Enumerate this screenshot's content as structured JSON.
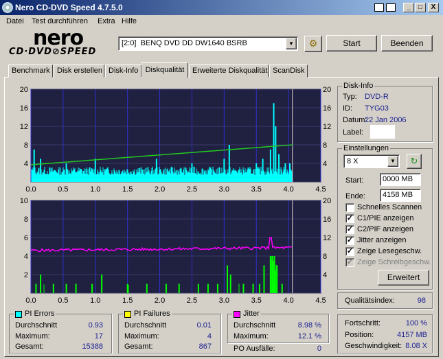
{
  "window": {
    "title": "Nero CD-DVD Speed 4.7.5.0",
    "min": "_",
    "max": "□",
    "close": "X"
  },
  "menu": [
    "Datei",
    "Test durchführen",
    "Extra",
    "Hilfe"
  ],
  "logo": {
    "top": "nero",
    "bottom": "CD·DVD⊘SPEED"
  },
  "drive": {
    "selected": "[2:0]  BENQ DVD DD DW1640 BSRB"
  },
  "buttons": {
    "start": "Start",
    "stop": "Beenden",
    "advanced": "Erweitert"
  },
  "tabs": [
    "Benchmark",
    "Disk erstellen",
    "Disk-Info",
    "Diskqualität",
    "Erweiterte Diskqualität",
    "ScanDisk"
  ],
  "active_tab": "Diskqualität",
  "disk_info": {
    "title": "Disk-Info",
    "type_label": "Typ:",
    "type": "DVD-R",
    "id_label": "ID:",
    "id": "TYG03",
    "date_label": "Datum:",
    "date": "22 Jan 2006",
    "label_label": "Label:"
  },
  "settings": {
    "title": "Einstellungen",
    "speed": "8 X",
    "start_label": "Start:",
    "start": "0000 MB",
    "end_label": "Ende:",
    "end": "4158 MB",
    "checks": [
      {
        "label": "Schnelles Scannen",
        "checked": false,
        "disabled": false
      },
      {
        "label": "C1/PIE anzeigen",
        "checked": true,
        "disabled": false
      },
      {
        "label": "C2/PIF anzeigen",
        "checked": true,
        "disabled": false
      },
      {
        "label": "Jitter anzeigen",
        "checked": true,
        "disabled": false
      },
      {
        "label": "Zeige Lesegeschw.",
        "checked": true,
        "disabled": false
      },
      {
        "label": "Zeige Schreibgeschw.",
        "checked": true,
        "disabled": true
      }
    ]
  },
  "quality": {
    "label": "Qualitätsindex:",
    "value": "98"
  },
  "progress": {
    "progress_label": "Fortschritt:",
    "progress": "100 %",
    "position_label": "Position:",
    "position": "4157 MB",
    "speed_label": "Geschwindigkeit:",
    "speed": "8.08 X"
  },
  "pi_errors": {
    "title": "PI Errors",
    "color": "#00ffff",
    "avg_label": "Durchschnitt",
    "avg": "0.93",
    "max_label": "Maximum:",
    "max": "17",
    "total_label": "Gesamt:",
    "total": "15388"
  },
  "pi_failures": {
    "title": "PI Failures",
    "color": "#ffff00",
    "avg_label": "Durchschnitt",
    "avg": "0.01",
    "max_label": "Maximum:",
    "max": "4",
    "total_label": "Gesamt:",
    "total": "867"
  },
  "jitter": {
    "title": "Jitter",
    "color": "#ff00ff",
    "avg_label": "Durchschnitt",
    "avg": "8.98 %",
    "max_label": "Maximum:",
    "max": "12.1 %",
    "po_label": "PO Ausfälle:",
    "po": "0"
  },
  "chart_data": [
    {
      "type": "bar",
      "name": "PI Errors",
      "x_ticks": [
        "0.0",
        "0.5",
        "1.0",
        "1.5",
        "2.0",
        "2.5",
        "3.0",
        "3.5",
        "4.0",
        "4.5"
      ],
      "y_left_ticks": [
        "20",
        "16",
        "12",
        "8",
        "4"
      ],
      "y_right_ticks": [
        "20",
        "16",
        "12",
        "8",
        "4"
      ],
      "xlim": [
        0,
        4.5
      ],
      "ylim": [
        0,
        20
      ],
      "bar_color": "#00ffff",
      "speed_line": {
        "color": "#22cc22",
        "start": [
          0.0,
          3.7
        ],
        "end": [
          4.06,
          8.0
        ]
      },
      "peaks": [
        [
          0.05,
          7
        ],
        [
          0.15,
          5
        ],
        [
          0.55,
          4
        ],
        [
          1.0,
          5
        ],
        [
          1.95,
          5
        ],
        [
          2.5,
          4
        ],
        [
          3.0,
          5
        ],
        [
          3.08,
          8
        ],
        [
          3.5,
          4
        ],
        [
          3.6,
          5
        ],
        [
          3.72,
          7
        ],
        [
          3.77,
          17
        ],
        [
          3.8,
          12
        ],
        [
          3.85,
          6
        ],
        [
          3.95,
          4
        ],
        [
          4.02,
          4
        ]
      ],
      "baseline": 1.5,
      "end_x": 4.06
    },
    {
      "type": "bar",
      "name": "PI Failures",
      "x_ticks": [
        "0.0",
        "0.5",
        "1.0",
        "1.5",
        "2.0",
        "2.5",
        "3.0",
        "3.5",
        "4.0",
        "4.5"
      ],
      "y_left_ticks": [
        "10",
        "8",
        "6",
        "4",
        "2"
      ],
      "y_right_ticks": [
        "20",
        "16",
        "12",
        "8",
        "4"
      ],
      "xlim": [
        0,
        4.5
      ],
      "ylim": [
        0,
        10
      ],
      "bar_color": "#00ff00",
      "jitter_color": "#ff00ff",
      "jitter_level": 4.6,
      "jitter_end": 4.9,
      "jitter_peak": [
        3.73,
        6.0
      ],
      "peaks": [
        [
          0.08,
          1
        ],
        [
          0.15,
          2
        ],
        [
          0.35,
          1
        ],
        [
          0.55,
          1
        ],
        [
          0.7,
          1
        ],
        [
          0.95,
          1
        ],
        [
          1.1,
          2
        ],
        [
          1.5,
          1
        ],
        [
          1.8,
          1
        ],
        [
          2.1,
          1
        ],
        [
          2.3,
          1
        ],
        [
          2.6,
          1
        ],
        [
          2.75,
          1
        ],
        [
          2.9,
          1
        ],
        [
          3.05,
          3
        ],
        [
          3.1,
          2
        ],
        [
          3.3,
          1
        ],
        [
          3.45,
          1
        ],
        [
          3.55,
          1
        ],
        [
          3.62,
          3
        ],
        [
          3.72,
          4
        ],
        [
          3.75,
          4
        ],
        [
          3.78,
          4
        ],
        [
          3.82,
          3
        ],
        [
          3.9,
          1
        ]
      ],
      "end_x": 4.06
    }
  ]
}
